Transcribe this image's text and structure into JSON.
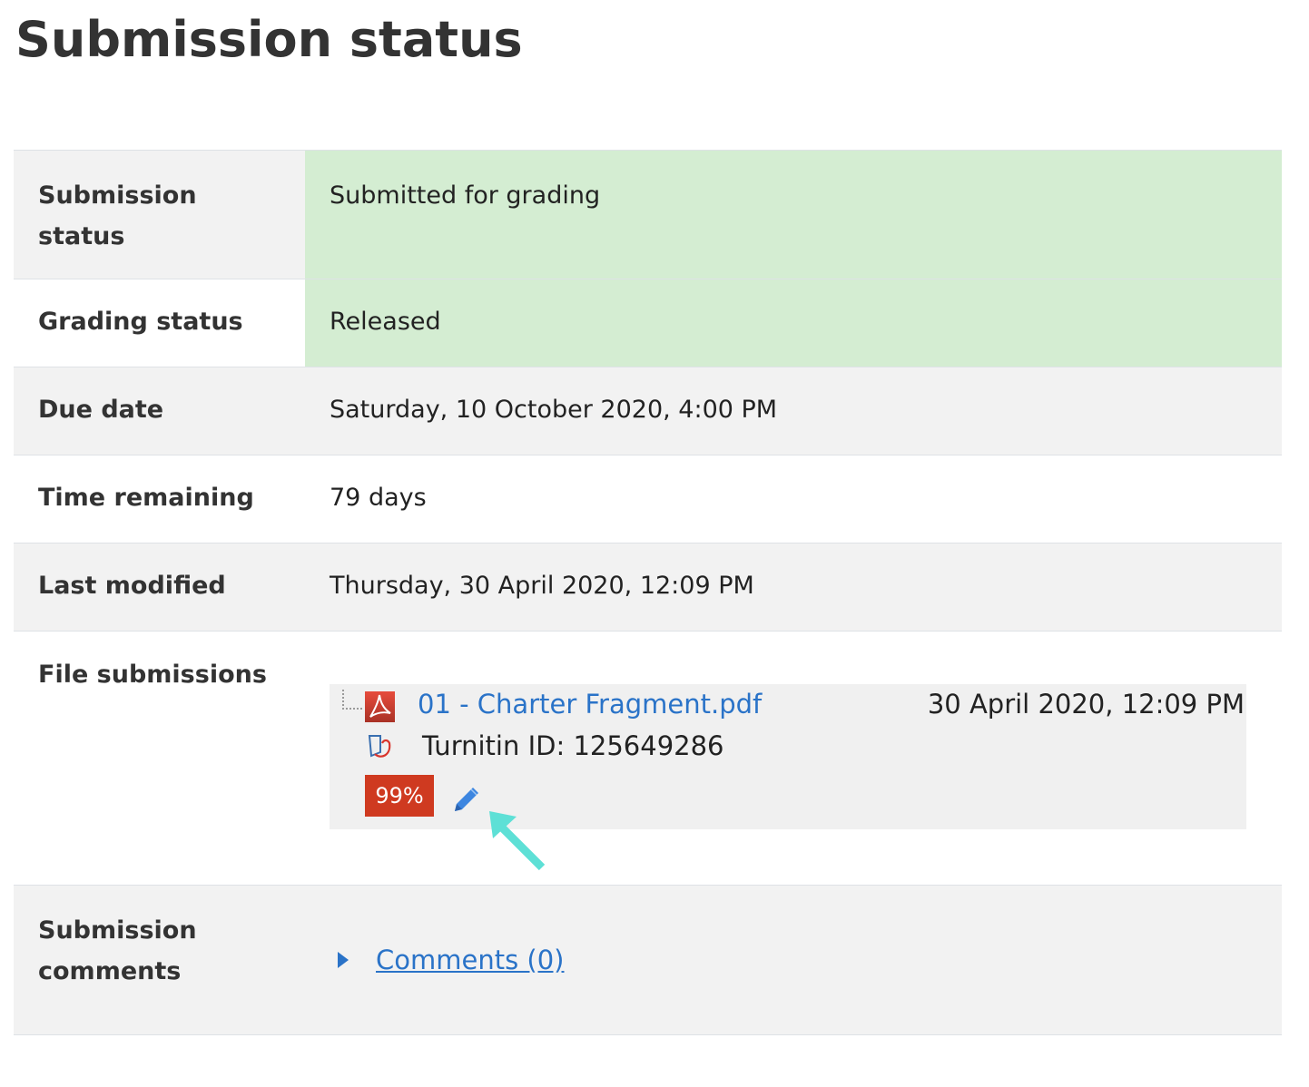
{
  "page": {
    "title": "Submission status"
  },
  "rows": {
    "submission_status": {
      "label_line1": "Submission",
      "label_line2": "status",
      "value": "Submitted for grading"
    },
    "grading_status": {
      "label": "Grading status",
      "value": "Released"
    },
    "due_date": {
      "label": "Due date",
      "value": "Saturday, 10 October 2020, 4:00 PM"
    },
    "time_remaining": {
      "label": "Time remaining",
      "value": "79 days"
    },
    "last_modified": {
      "label": "Last modified",
      "value": "Thursday, 30 April 2020, 12:09 PM"
    },
    "file_submissions": {
      "label": "File submissions",
      "file": {
        "icon": "pdf-icon",
        "name": "01 - Charter Fragment.pdf",
        "date": "30 April 2020, 12:09 PM",
        "turnitin_icon": "turnitin-icon",
        "turnitin_id": "Turnitin ID: 125649286",
        "similarity_score": "99%",
        "edit_icon": "pencil-icon"
      }
    },
    "submission_comments": {
      "label_line1": "Submission",
      "label_line2": "comments",
      "toggle_icon": "caret-right-icon",
      "link": "Comments (0)"
    }
  },
  "colors": {
    "green_status": "#d4edd2",
    "link": "#2a73c8",
    "score_badge": "#cf3a20",
    "annotation_arrow": "#5ee0d6",
    "row_shade": "#f2f2f2"
  },
  "annotation": {
    "icon": "arrow-up-left-icon"
  }
}
